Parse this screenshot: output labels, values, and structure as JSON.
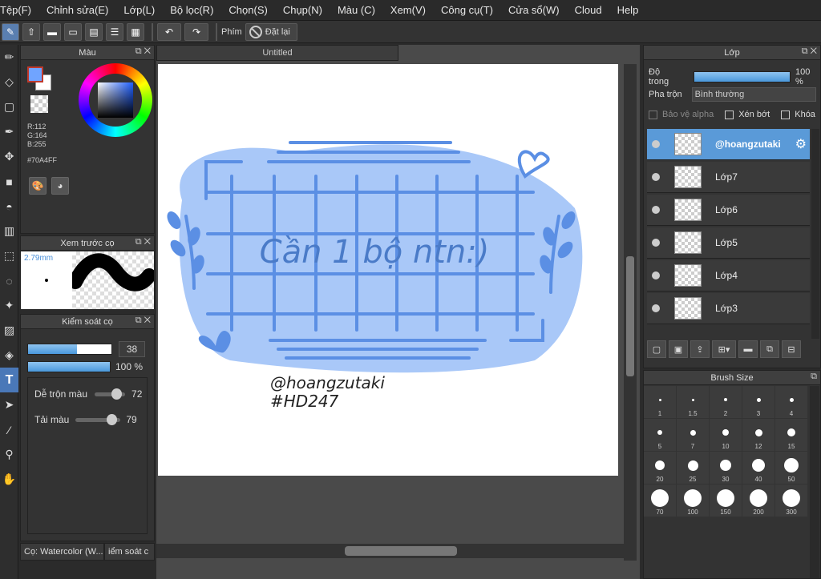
{
  "menu": [
    "Tệp(F)",
    "Chỉnh sửa(E)",
    "Lớp(L)",
    "Bộ lọc(R)",
    "Chọn(S)",
    "Chụp(N)",
    "Màu (C)",
    "Xem(V)",
    "Công cụ(T)",
    "Cửa sổ(W)",
    "Cloud",
    "Help"
  ],
  "toolbar": {
    "phim_label": "Phím",
    "reset_label": "Đặt lại"
  },
  "color_panel": {
    "title": "Màu",
    "r": "R:112",
    "g": "G:164",
    "b": "B:255",
    "hex": "#70A4FF",
    "fg": "#70A4FF"
  },
  "preview_panel": {
    "title": "Xem trước cọ",
    "size": "2.79mm"
  },
  "brush_ctrl": {
    "title": "Kiểm soát cọ",
    "size_value": "38",
    "size_fraction": 0.59,
    "opacity_value": "100 %",
    "opacity_fraction": 1.0,
    "blend_label": "Dễ trộn màu",
    "blend_value": "72",
    "blend_fraction": 0.72,
    "density_label": "Tải màu",
    "density_value": "79",
    "density_fraction": 0.79
  },
  "bottom_tabs": [
    "Cọ: Watercolor (W...",
    "iểm soát c"
  ],
  "document": {
    "tab": "Untitled",
    "text_main": "Cần 1 bộ ntn:)",
    "signature1": "@hoangzutaki",
    "signature2": "#HD247",
    "blob_color": "#a9c8f8",
    "line_color": "#5b8fe4"
  },
  "layer_panel": {
    "title": "Lớp",
    "opacity_label": "Độ trong",
    "opacity_value": "100 %",
    "opacity_fraction": 1.0,
    "blend_label": "Pha trộn",
    "blend_mode": "Bình thường",
    "protect_alpha": "Bảo vệ alpha",
    "clipping": "Xén bớt",
    "lock": "Khóa",
    "layers": [
      {
        "name": "@hoangzutaki",
        "selected": true
      },
      {
        "name": "Lớp7",
        "selected": false
      },
      {
        "name": "Lớp6",
        "selected": false
      },
      {
        "name": "Lớp5",
        "selected": false
      },
      {
        "name": "Lớp4",
        "selected": false
      },
      {
        "name": "Lớp3",
        "selected": false
      }
    ]
  },
  "brush_size": {
    "title": "Brush Size",
    "sizes": [
      "1",
      "1.5",
      "2",
      "3",
      "4",
      "5",
      "7",
      "10",
      "12",
      "15",
      "20",
      "25",
      "30",
      "40",
      "50",
      "70",
      "100",
      "150",
      "200",
      "300"
    ]
  }
}
